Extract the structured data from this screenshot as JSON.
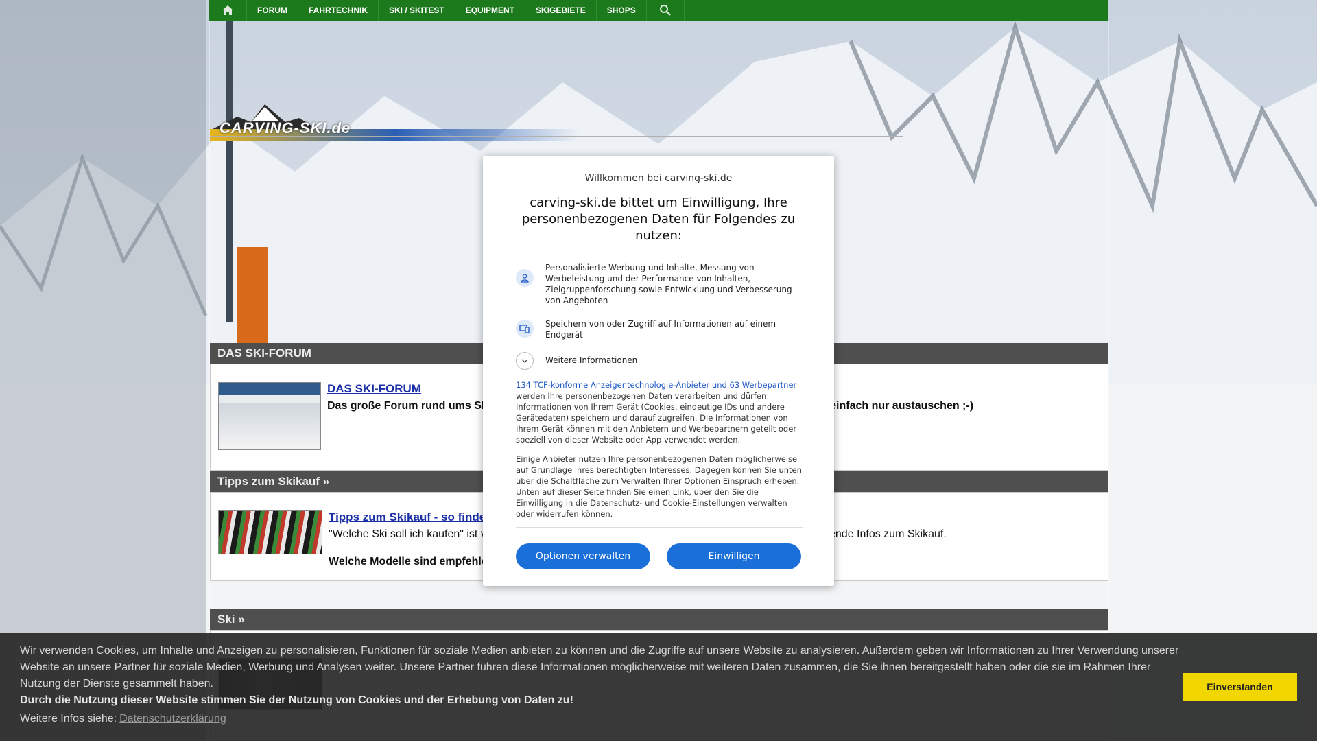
{
  "nav": {
    "items": [
      "FORUM",
      "FAHRTECHNIK",
      "SKI / SKITEST",
      "EQUIPMENT",
      "SKIGEBIETE",
      "SHOPS"
    ]
  },
  "logo": {
    "text": "CARVING-SKI.de"
  },
  "sections": {
    "forum": {
      "header": "DAS SKI-FORUM",
      "title": "DAS SKI-FORUM",
      "desc_left": "Das große Forum rund ums Sk",
      "desc_right": "ch einfach nur austauschen ;-)"
    },
    "tipps": {
      "header": "Tipps zum Skikauf »",
      "title": "Tipps zum Skikauf - so finde",
      "desc_left": "\"Welche Ski soll ich kaufen\" ist v",
      "desc_right": "ende Infos zum Skikauf.",
      "desc2": "Welche Modelle sind empfehle"
    },
    "ski": {
      "header": "Ski »"
    }
  },
  "consent": {
    "welcome": "Willkommen bei carving-ski.de",
    "headline": "carving-ski.de bittet um Einwilligung, Ihre personenbezogenen Daten für Folgendes zu nutzen:",
    "purpose1": "Personalisierte Werbung und Inhalte, Messung von Werbeleistung und der Performance von Inhalten, Zielgruppenforschung sowie Entwicklung und Verbesserung von Angeboten",
    "purpose2": "Speichern von oder Zugriff auf Informationen auf einem Endgerät",
    "more": "Weitere Informationen",
    "partners_link": "134 TCF-konforme Anzeigentechnologie-Anbieter und 63 Werbepartner",
    "para1_rest": " werden Ihre personenbezogenen Daten verarbeiten und dürfen Informationen von Ihrem Gerät (Cookies, eindeutige IDs und andere Gerätedaten) speichern und darauf zugreifen. Die Informationen von Ihrem Gerät können mit den Anbietern und Werbepartnern geteilt oder speziell von dieser Website oder App verwendet werden.",
    "para2": "Einige Anbieter nutzen Ihre personenbezogenen Daten möglicherweise auf Grundlage ihres berechtigten Interesses. Dagegen können Sie unten über die Schaltfläche zum Verwalten Ihrer Optionen Einspruch erheben. Unten auf dieser Seite finden Sie einen Link, über den Sie die Einwilligung in die Datenschutz- und Cookie-Einstellungen verwalten oder widerrufen können.",
    "btn_manage": "Optionen verwalten",
    "btn_accept": "Einwilligen"
  },
  "cookie": {
    "text": "Wir verwenden Cookies, um Inhalte und Anzeigen zu personalisieren, Funktionen für soziale Medien anbieten zu können und die Zugriffe auf unsere Website zu analysieren. Außerdem geben wir Informationen zu Ihrer Verwendung unserer Website an unsere Partner für soziale Medien, Werbung und Analysen weiter. Unsere Partner führen diese Informationen möglicherweise mit weiteren Daten zusammen, die Sie ihnen bereitgestellt haben oder die sie im Rahmen Ihrer Nutzung der Dienste gesammelt haben.",
    "bold": "Durch die Nutzung dieser Website stimmen Sie der Nutzung von Cookies und der Erhebung von Daten zu!",
    "more_label": "Weitere Infos siehe:",
    "link": "Datenschutzerklärung",
    "accept": "Einverstanden"
  },
  "colors": {
    "nav_green": "#1c7a1c",
    "consent_blue": "#1a6fd8",
    "cookie_yellow": "#f1d600"
  }
}
